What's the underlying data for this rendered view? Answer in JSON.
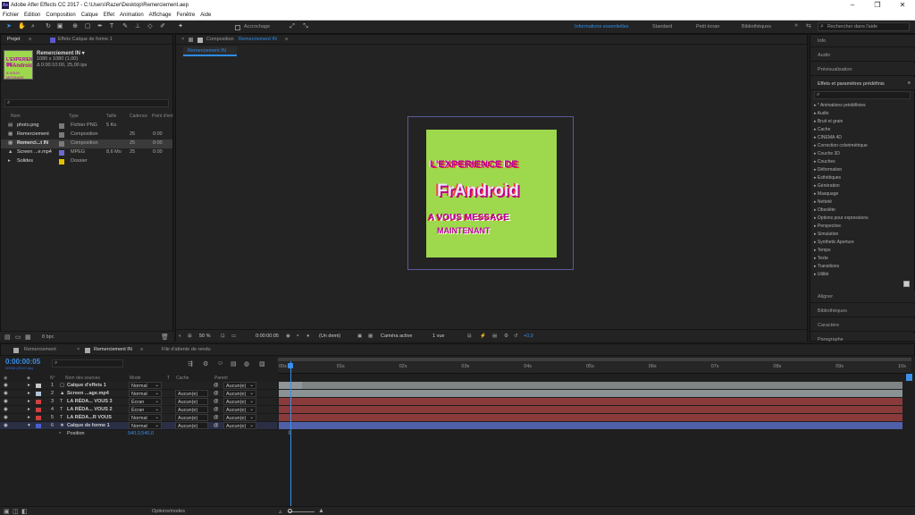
{
  "window": {
    "title": "Adobe After Effects CC 2017 - C:\\Users\\Razer\\Desktop\\Remerciement.aep",
    "app_badge": "Ae"
  },
  "menu": [
    "Fichier",
    "Edition",
    "Composition",
    "Calque",
    "Effet",
    "Animation",
    "Affichage",
    "Fenêtre",
    "Aide"
  ],
  "toolbar": {
    "snap_label": "Accrochage",
    "workspaces": [
      "Informations essentielles",
      "Standard",
      "Petit écran",
      "Bibliothèques"
    ],
    "active_workspace": "Informations essentielles",
    "search_placeholder": "Rechercher dans l'aide"
  },
  "project": {
    "tab_project": "Projet",
    "tab_effects": "Effets  Calque de forme 1",
    "selected_name": "Remerciement IN ▾",
    "selected_info1": "1080 x 1080 (1,00)",
    "selected_info2": "Δ 0:00:10:00, 25,00 ips",
    "thumb": {
      "line1": "L'EXPERIENCE DE",
      "line2": "FrAndroid",
      "line3": "A VOUS MESSAGE"
    },
    "columns": [
      "Nom",
      "Type",
      "Taille",
      "Cadence",
      "Point d'ent"
    ],
    "items": [
      {
        "name": "photo.png",
        "type": "Fichier PNG",
        "size": "5 Ko",
        "rate": "",
        "in": "",
        "color": "#7a7a7a"
      },
      {
        "name": "Remerciement",
        "type": "Composition",
        "size": "",
        "rate": "25",
        "in": "0:00",
        "color": "#7a7a7a"
      },
      {
        "name": "Remerci...t IN",
        "type": "Composition",
        "size": "",
        "rate": "25",
        "in": "0:00",
        "color": "#7a7a7a"
      },
      {
        "name": "Screen ...e.mp4",
        "type": "MPEG",
        "size": "8,6 Mo",
        "rate": "25",
        "in": "0:00",
        "color": "#6a6ad0"
      },
      {
        "name": "Solides",
        "type": "Dossier",
        "size": "",
        "rate": "",
        "in": "",
        "color": "#e5c000"
      }
    ],
    "bpc": "8 bpc"
  },
  "composition": {
    "tab_label": "Composition",
    "tab_name": "Remerciement IN",
    "sub_tab": "Remerciement IN",
    "canvas_text": {
      "line1": "L'EXPERIENCE DE",
      "line2": "FrAndroid",
      "line3": "A VOUS MESSAGE",
      "line4": "MAINTENANT"
    },
    "footer": {
      "zoom": "50 %",
      "timecode": "0:00:00:05",
      "resolution": "(Un demi)",
      "camera": "Caméra active",
      "views": "1 vue",
      "exposure": "+0,0"
    }
  },
  "right_panel": {
    "sections_top": [
      "Info",
      "Audio",
      "Prévisualisation"
    ],
    "effects_title": "Effets et paramètres prédéfinis",
    "effects": [
      "* Animations prédéfinies",
      "Audio",
      "Bruit et grain",
      "Cache",
      "CINEMA 4D",
      "Correction colorimétrique",
      "Couche 3D",
      "Couches",
      "Déformation",
      "Esthétiques",
      "Génération",
      "Masquage",
      "Netteté",
      "Obsolète",
      "Options pour expressions",
      "Perspective",
      "Simulation",
      "Synthetic Aperture",
      "Temps",
      "Texte",
      "Transitions",
      "Utilité"
    ],
    "sections_bottom": [
      "Aligner",
      "Bibliothèques",
      "Caractère",
      "Paragraphe"
    ]
  },
  "timeline": {
    "tabs": [
      "Remerciement",
      "Remerciement IN",
      "File d'attente de rendu"
    ],
    "timecode": "0:00:00:05",
    "fps": "00005 (25.00 ips)",
    "col_headers": [
      "N°",
      "Nom des sources",
      "Mode",
      "T",
      "Cache",
      "Parent"
    ],
    "layers": [
      {
        "num": "1",
        "name": "Calque d'effets 1",
        "mode": "Normal",
        "cache": "",
        "parent": "Aucun(e)",
        "color": "#c8c8c8",
        "bar": "#7f8485"
      },
      {
        "num": "2",
        "name": "Screen ...age.mp4",
        "mode": "Normal",
        "cache": "Aucun(e)",
        "parent": "Aucun(e)",
        "color": "#b1c6d8",
        "bar": "#8a9294"
      },
      {
        "num": "3",
        "name": "LA RÉDA... VOUS 3",
        "mode": "Écran",
        "cache": "Aucun(e)",
        "parent": "Aucun(e)",
        "color": "#d04040",
        "bar": "#8a3a3a"
      },
      {
        "num": "4",
        "name": "LA RÉDA... VOUS 2",
        "mode": "Écran",
        "cache": "Aucun(e)",
        "parent": "Aucun(e)",
        "color": "#d04040",
        "bar": "#8a3a3a"
      },
      {
        "num": "5",
        "name": "LA RÉDA...R VOUS",
        "mode": "Normal",
        "cache": "Aucun(e)",
        "parent": "Aucun(e)",
        "color": "#d04040",
        "bar": "#8a3a3a"
      },
      {
        "num": "6",
        "name": "Calque de forme 1",
        "mode": "Normal",
        "cache": "Aucun(e)",
        "parent": "Aucun(e)",
        "color": "#4a5fcf",
        "bar": "#5060a8"
      }
    ],
    "position_label": "Position",
    "position_value": "540,0,540,0",
    "ruler": [
      "00s",
      "01s",
      "02s",
      "03s",
      "04s",
      "05s",
      "06s",
      "07s",
      "08s",
      "09s",
      "10s"
    ],
    "footer_label": "Options/modes"
  }
}
